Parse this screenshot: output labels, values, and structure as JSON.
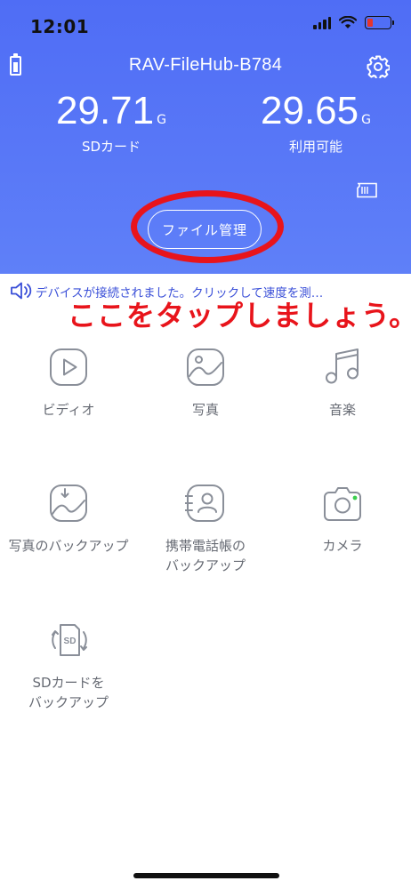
{
  "status_bar": {
    "time": "12:01"
  },
  "header": {
    "device_name": "RAV-FileHub-B784",
    "sd_card": {
      "value": "29.71",
      "unit": "G",
      "label": "SDカード"
    },
    "available": {
      "value": "29.65",
      "unit": "G",
      "label": "利用可能"
    },
    "file_manager_label": "ファイル管理"
  },
  "notice": {
    "text": "デバイスが接続されました。クリックして速度を測…"
  },
  "annotation": {
    "caption": "ここをタップしましょう。",
    "color": "#e8141b"
  },
  "menu": {
    "video": "ビディオ",
    "photos": "写真",
    "music": "音楽",
    "photo_backup": "写真のバックアップ",
    "contacts_backup_line1": "携帯電話帳の",
    "contacts_backup_line2": "バックアップ",
    "camera": "カメラ",
    "sd_backup_line1": "SDカードを",
    "sd_backup_line2": "バックアップ",
    "sd_icon_text": "SD"
  },
  "colors": {
    "header_blue": "#5877f7",
    "icon_gray": "#8a8f99",
    "notice_text": "#3a4fd8",
    "camera_dot": "#3ccf4e"
  },
  "icons": [
    "battery-icon",
    "gear-icon",
    "sd-card-icon",
    "speaker-icon",
    "video-icon",
    "photo-icon",
    "music-icon",
    "photo-backup-icon",
    "contacts-icon",
    "camera-icon",
    "sd-backup-icon"
  ]
}
